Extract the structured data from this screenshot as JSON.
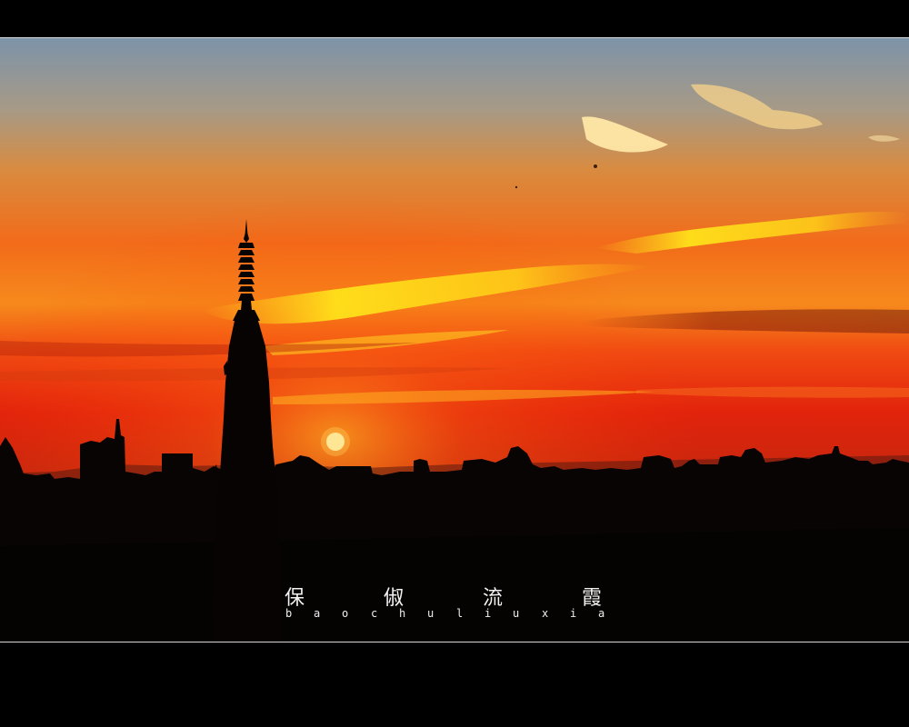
{
  "caption": {
    "title_chars": [
      "保",
      "俶",
      "流",
      "霞"
    ],
    "romanization_letters": [
      "b",
      "a",
      "o",
      "c",
      "h",
      "u",
      "l",
      "i",
      "u",
      "x",
      "i",
      "a"
    ]
  }
}
